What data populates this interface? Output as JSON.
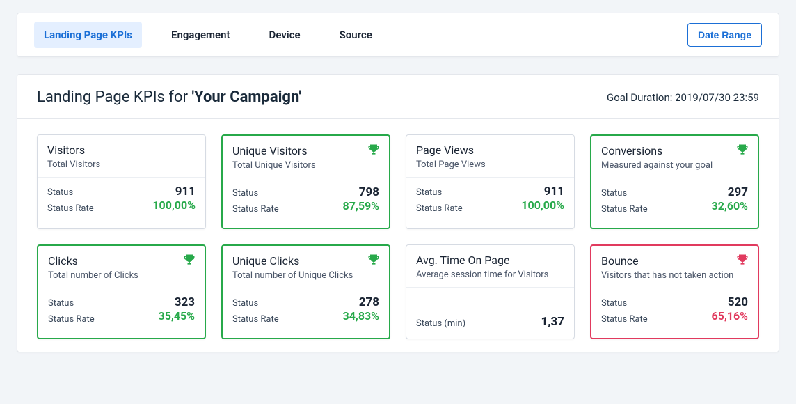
{
  "tabs": {
    "landing": "Landing Page KPIs",
    "engagement": "Engagement",
    "device": "Device",
    "source": "Source"
  },
  "date_range_label": "Date Range",
  "panel": {
    "title_prefix": "Landing Page KPIs for  ",
    "title_bold": "'Your Campaign'",
    "goal_label": "Goal Duration: ",
    "goal_value": "2019/07/30 23:59"
  },
  "labels": {
    "status": "Status",
    "status_rate": "Status Rate",
    "status_min": "Status (min)"
  },
  "cards": {
    "visitors": {
      "title": "Visitors",
      "sub": "Total Visitors",
      "value": "911",
      "rate": "100,00%"
    },
    "unique_visitors": {
      "title": "Unique Visitors",
      "sub": "Total Unique Visitors",
      "value": "798",
      "rate": "87,59%"
    },
    "page_views": {
      "title": "Page Views",
      "sub": "Total Page Views",
      "value": "911",
      "rate": "100,00%"
    },
    "conversions": {
      "title": "Conversions",
      "sub": "Measured against your goal",
      "value": "297",
      "rate": "32,60%"
    },
    "clicks": {
      "title": "Clicks",
      "sub": "Total number of Clicks",
      "value": "323",
      "rate": "35,45%"
    },
    "unique_clicks": {
      "title": "Unique Clicks",
      "sub": "Total number of Unique Clicks",
      "value": "278",
      "rate": "34,83%"
    },
    "avg_time": {
      "title": "Avg. Time On Page",
      "sub": "Average session time for Visitors",
      "value": "1,37"
    },
    "bounce": {
      "title": "Bounce",
      "sub": "Visitors that has not taken action",
      "value": "520",
      "rate": "65,16%"
    }
  }
}
